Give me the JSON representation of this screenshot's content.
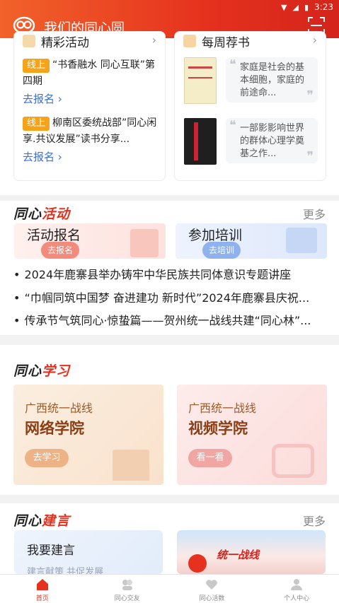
{
  "status_bar": {
    "time": "3:23"
  },
  "header": {
    "title": "我们的同心圆"
  },
  "cards": {
    "activities": {
      "title": "精彩活动",
      "items": [
        {
          "tag": "线上",
          "text": "“书香融水 同心互联”第四期",
          "link": "去报名"
        },
        {
          "tag": "线上",
          "text": "柳南区委统战部”同心闲享.共议发展”读书分享...",
          "link": "去报名"
        }
      ]
    },
    "books": {
      "title": "每周荐书",
      "items": [
        {
          "quote": "家庭是社会的基本细胞，家庭的前途命..."
        },
        {
          "quote": "一部影影响世界的群体心理学奠基之作..."
        }
      ]
    }
  },
  "activity_section": {
    "title_black": "同心",
    "title_red": "活动",
    "more": "更多",
    "banners": [
      {
        "title": "活动报名",
        "button": "去报名"
      },
      {
        "title": "参加培训",
        "button": "去培训"
      }
    ],
    "news": [
      "2024年鹿寨县举办铸牢中华民族共同体意识专题讲座",
      "“巾帼同筑中国梦 奋进建功 新时代”2024年鹿寨县庆祝...",
      "传承节气筑同心·惊蛰篇——贺州统一战线共建“同心林”..."
    ]
  },
  "study_section": {
    "title_black": "同心",
    "title_red": "学习",
    "cards": [
      {
        "line1": "广西统一战线",
        "line2": "网络学院",
        "button": "去学习"
      },
      {
        "line1": "广西统一战线",
        "line2": "视频学院",
        "button": "看一看"
      }
    ]
  },
  "suggest_section": {
    "title_black": "同心",
    "title_red": "建言",
    "more": "更多",
    "card_title": "我要建言",
    "card_sub": "建言献策 共促发展",
    "banner_text": "统一战线"
  },
  "bottom_nav": [
    {
      "label": "首页",
      "active": true
    },
    {
      "label": "同心交友",
      "active": false
    },
    {
      "label": "同心活数",
      "active": false
    },
    {
      "label": "个人中心",
      "active": false
    }
  ],
  "colors": {
    "primary": "#e5321e",
    "accent": "#f4a31a",
    "link": "#3d6fd8"
  }
}
